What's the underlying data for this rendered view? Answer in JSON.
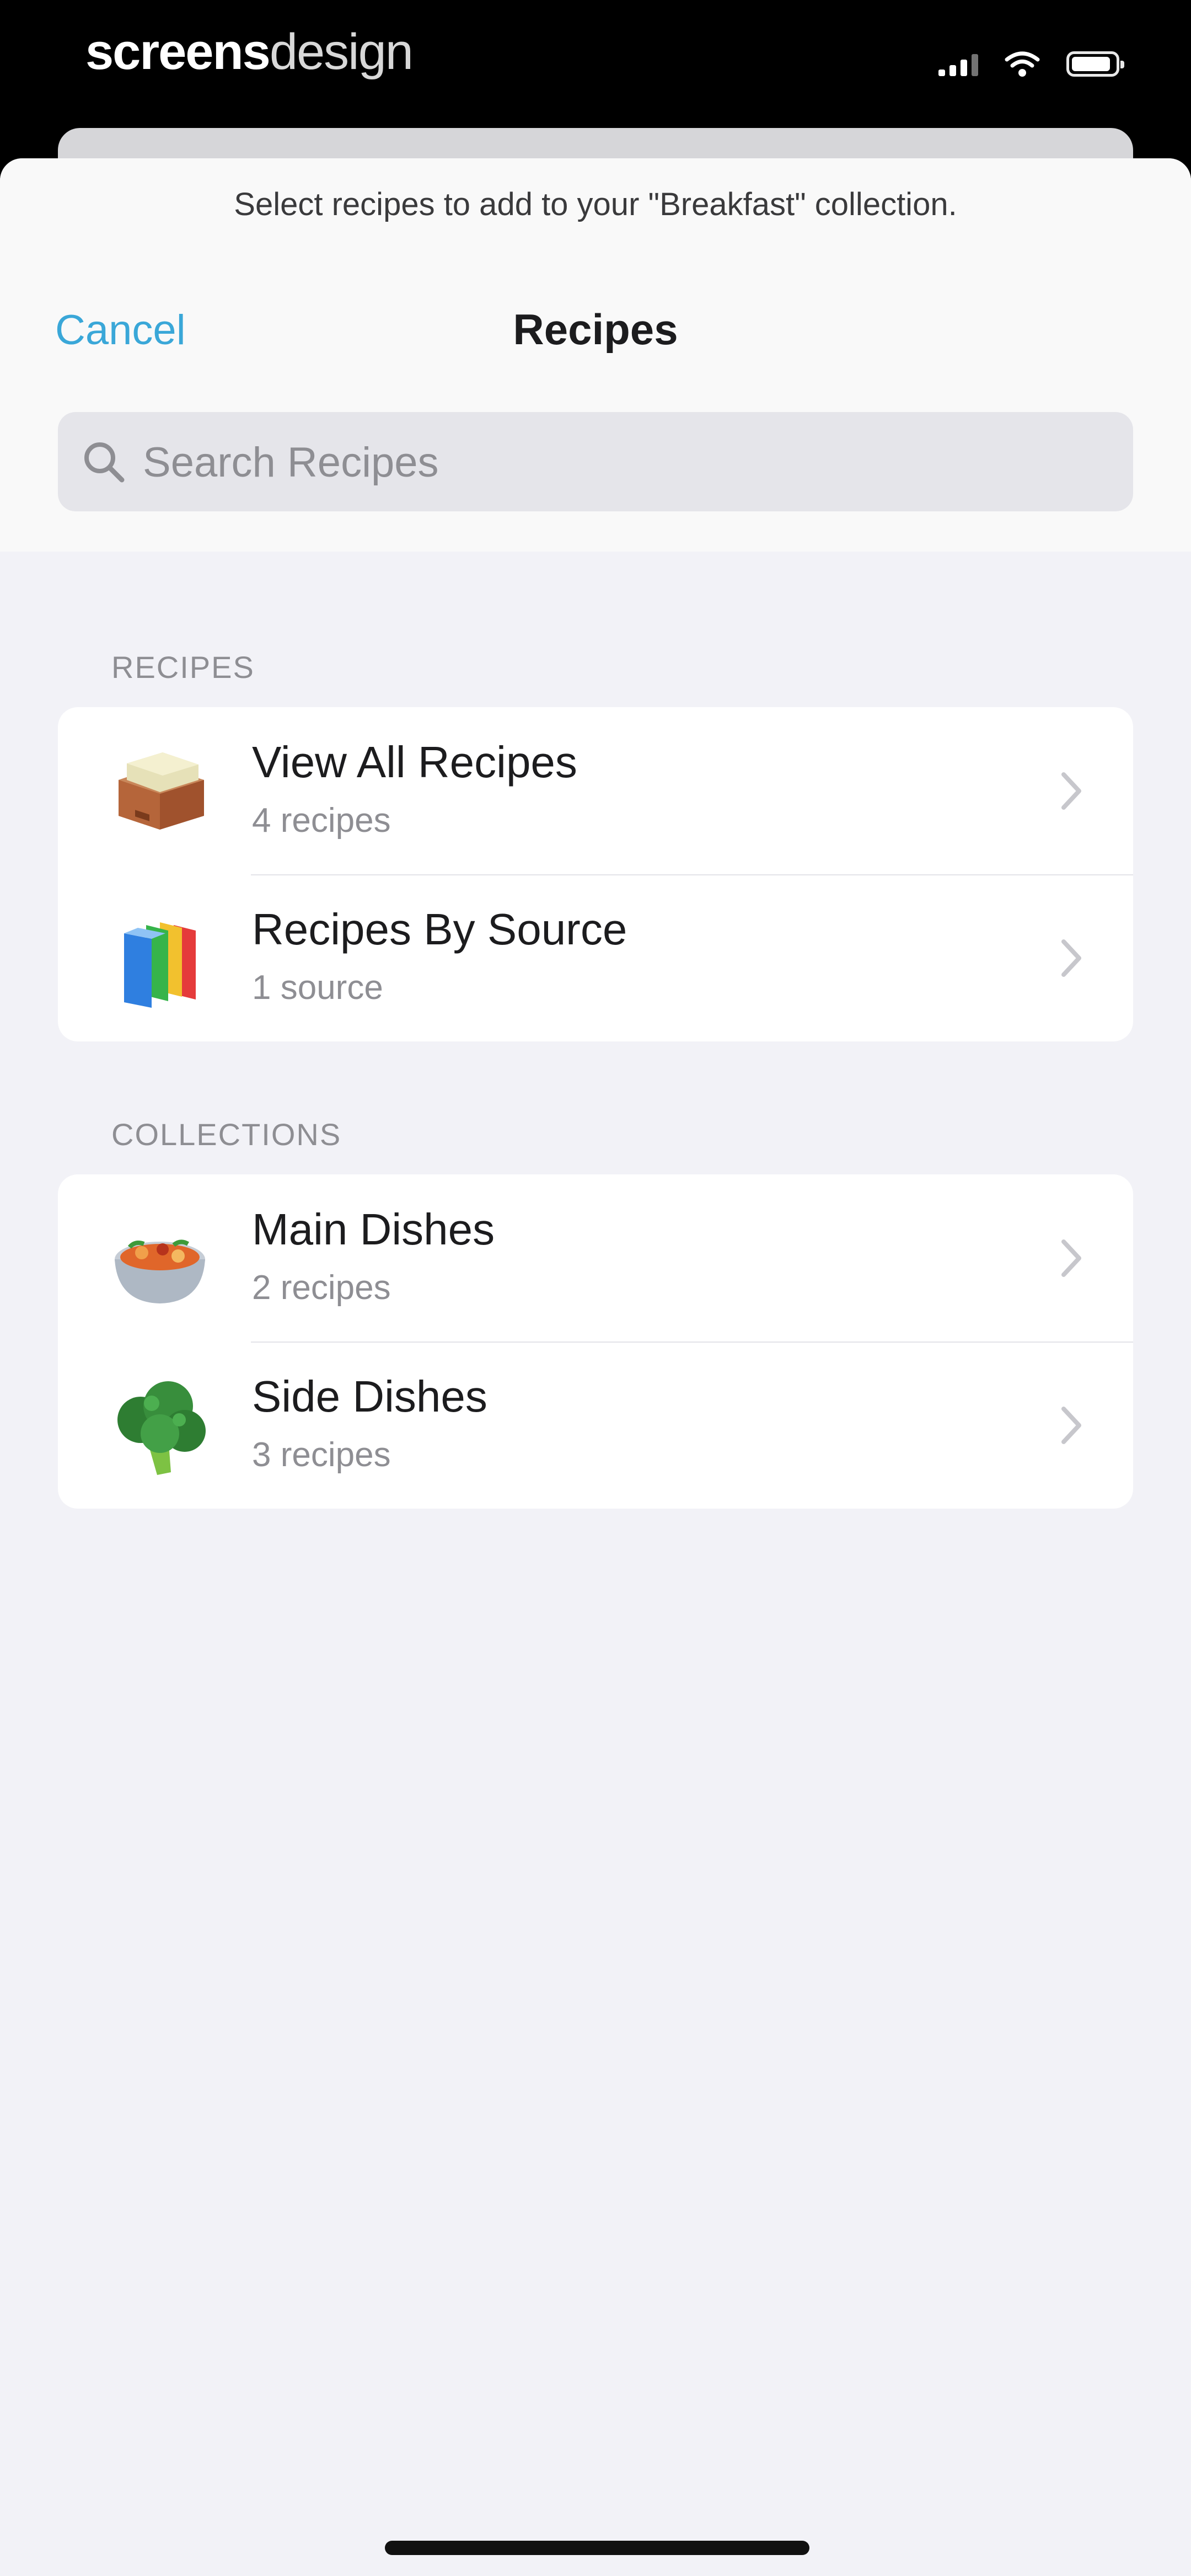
{
  "status_bar": {
    "brand_bold": "screens",
    "brand_light": "design",
    "icons": [
      "cellular-signal-icon",
      "wifi-icon",
      "battery-icon"
    ]
  },
  "sheet": {
    "prompt": "Select recipes to add to your \"Breakfast\" collection.",
    "nav": {
      "cancel_label": "Cancel",
      "title": "Recipes"
    },
    "search": {
      "placeholder": "Search Recipes",
      "value": ""
    }
  },
  "sections": [
    {
      "header": "RECIPES",
      "rows": [
        {
          "title": "View All Recipes",
          "subtitle": "4 recipes",
          "icon": "recipe-box-icon"
        },
        {
          "title": "Recipes By Source",
          "subtitle": "1 source",
          "icon": "books-icon"
        }
      ]
    },
    {
      "header": "COLLECTIONS",
      "rows": [
        {
          "title": "Main Dishes",
          "subtitle": "2 recipes",
          "icon": "curry-bowl-icon"
        },
        {
          "title": "Side Dishes",
          "subtitle": "3 recipes",
          "icon": "broccoli-icon"
        }
      ]
    }
  ],
  "colors": {
    "accent": "#3aa7d8",
    "background": "#f2f2f7",
    "card": "#ffffff",
    "secondary_text": "#8e8e93"
  }
}
